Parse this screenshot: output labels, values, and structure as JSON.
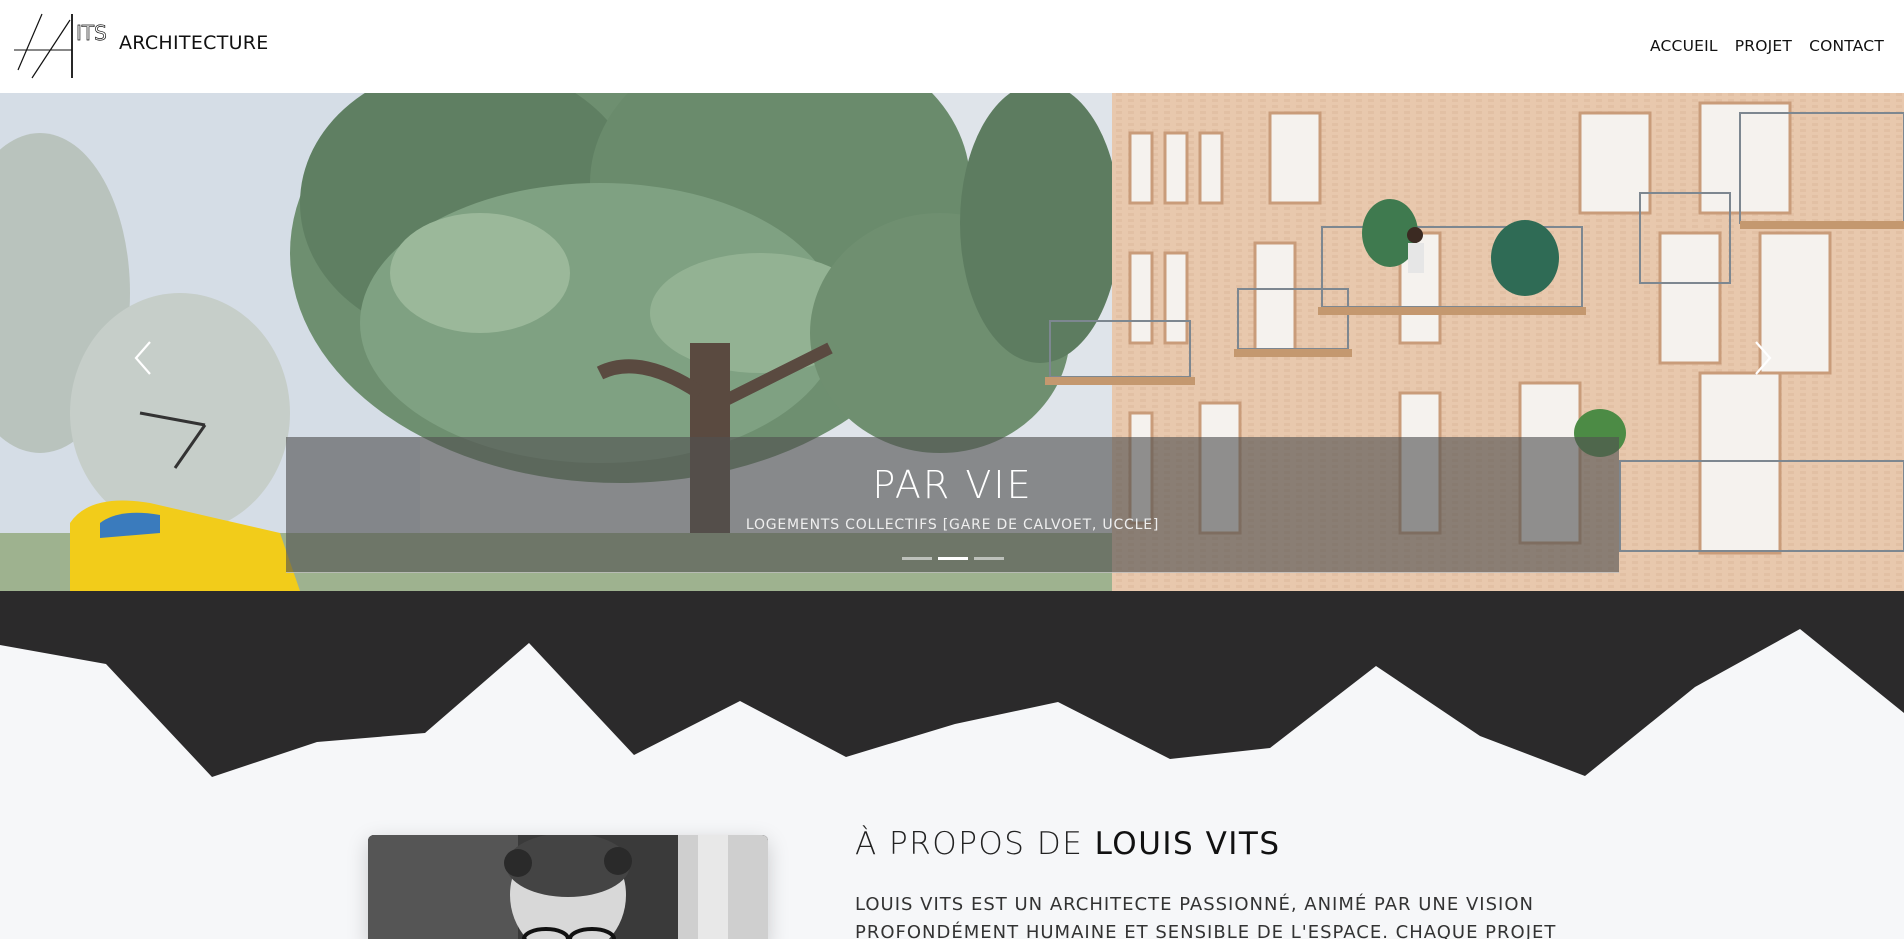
{
  "header": {
    "logo_text": "VITS",
    "brand": "ARCHITECTURE",
    "nav": [
      {
        "label": "ACCUEIL"
      },
      {
        "label": "PROJET"
      },
      {
        "label": "CONTACT"
      }
    ]
  },
  "carousel": {
    "title": "PAR VIE",
    "subtitle": "LOGEMENTS COLLECTIFS [GARE DE CALVOET, UCCLE]",
    "slide_count": 3,
    "active_slide": 2,
    "prev_icon": "chevron-left-icon",
    "next_icon": "chevron-right-icon"
  },
  "about": {
    "title_prefix": "À PROPOS DE ",
    "title_name": "LOUIS VITS",
    "text": "LOUIS VITS EST UN ARCHITECTE PASSIONNÉ, ANIMÉ PAR UNE VISION PROFONDÉMENT HUMAINE ET SENSIBLE DE L'ESPACE. CHAQUE PROJET QU'IL"
  },
  "colors": {
    "dark_band": "#2b2a2b",
    "background": "#f6f7f9",
    "caption_overlay": "rgba(80,80,80,0.62)"
  }
}
